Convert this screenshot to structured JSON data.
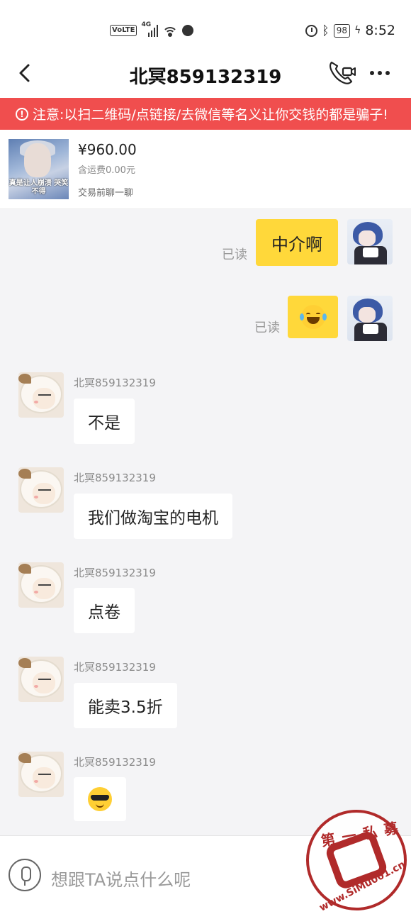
{
  "status_bar": {
    "network_label": "VoLTE",
    "signal_label": "4G",
    "battery": "98",
    "time": "8:52"
  },
  "header": {
    "title": "北冥859132319"
  },
  "warning": {
    "text": "注意:以扫二维码/点链接/去微信等名义让你交钱的都是骗子!"
  },
  "product": {
    "price": "¥960.00",
    "shipping": "含运费0.00元",
    "chat_hint": "交易前聊一聊",
    "image_caption": "真是让人崩溃 哭笑不得"
  },
  "messages": {
    "out": [
      {
        "read": "已读",
        "text": "中介啊"
      },
      {
        "read": "已读",
        "emoji": "laughing-tears"
      }
    ],
    "in": [
      {
        "sender": "北冥859132319",
        "text": "不是"
      },
      {
        "sender": "北冥859132319",
        "text": "我们做淘宝的电机"
      },
      {
        "sender": "北冥859132319",
        "text": "点卷"
      },
      {
        "sender": "北冥859132319",
        "text": "能卖3.5折"
      },
      {
        "sender": "北冥859132319",
        "emoji": "sunglasses"
      }
    ]
  },
  "input": {
    "placeholder": "想跟TA说点什么呢"
  },
  "watermark": {
    "top_text": "第一私募",
    "bottom_text": "www.SiMu001.cn"
  },
  "colors": {
    "warning_bg": "#f04e4e",
    "own_bubble": "#ffd83a",
    "watermark": "#b02a2a"
  }
}
